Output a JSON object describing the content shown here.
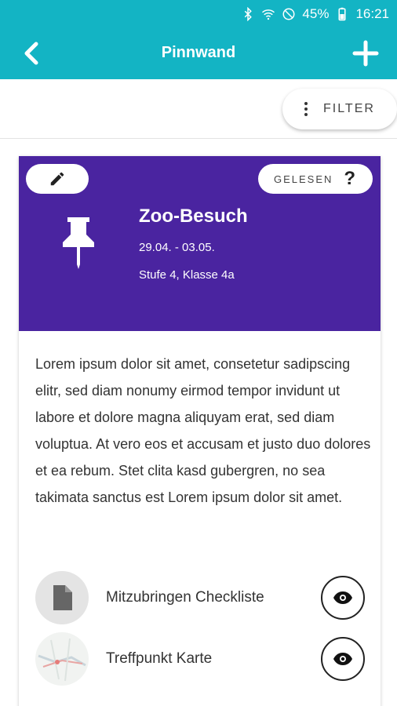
{
  "status_bar": {
    "battery": "45%",
    "time": "16:21",
    "icons": [
      "bluetooth-icon",
      "wifi-icon",
      "do-not-disturb-icon",
      "battery-icon"
    ]
  },
  "toolbar": {
    "title": "Pinnwand",
    "back_icon": "chevron-left-icon",
    "add_icon": "plus-icon"
  },
  "filter": {
    "label": "FILTER",
    "icon": "more-vertical-icon"
  },
  "card": {
    "header_color": "#4a24a0",
    "edit_icon": "pencil-icon",
    "read_label": "GELESEN",
    "read_icon": "question-icon",
    "pin_icon": "pushpin-icon",
    "title": "Zoo-Besuch",
    "date": "29.04. - 03.05.",
    "class": "Stufe 4, Klasse 4a",
    "body": "Lorem ipsum dolor sit amet, consetetur sadipscing elitr, sed diam nonumy eirmod tempor invidunt ut labore et dolore magna aliquyam erat, sed diam voluptua. At vero eos et accusam et justo duo dolores et ea rebum. Stet clita kasd gubergren, no sea takimata sanctus est Lorem ipsum dolor sit amet.",
    "attachments": [
      {
        "name": "Mitzubringen Checkliste",
        "icon": "document-icon",
        "view_icon": "eye-icon"
      },
      {
        "name": "Treffpunkt Karte",
        "icon": "map-thumbnail",
        "view_icon": "eye-icon"
      }
    ]
  },
  "colors": {
    "appbar": "#13b4c4",
    "accent": "#4a24a0"
  }
}
